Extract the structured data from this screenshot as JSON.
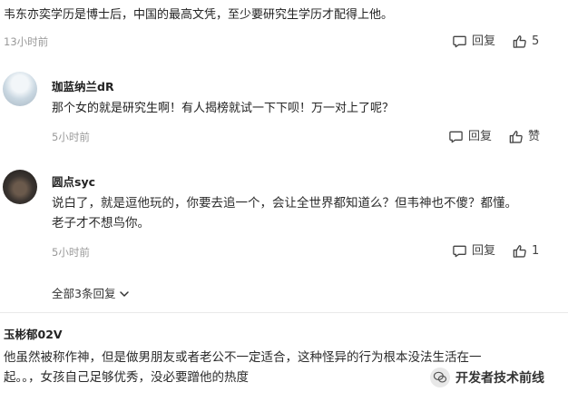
{
  "comment0": {
    "text": "韦东亦奕学历是博士后，中国的最高文凭，至少要研究生学历才配得上他。",
    "time": "13小时前",
    "reply_label": "回复",
    "like_count": "5"
  },
  "comment1": {
    "username": "珈蓝纳兰dR",
    "text": "那个女的就是研究生啊！有人揭榜就试一下下呗！万一对上了呢？",
    "time": "5小时前",
    "reply_label": "回复",
    "like_label": "赞"
  },
  "comment2": {
    "username": "圆点syc",
    "text_line1": "说白了，就是逗他玩的，你要去追一个，会让全世界都知道么？但韦神也不傻？都懂。",
    "text_line2": "老子才不想鸟你。",
    "time": "5小时前",
    "reply_label": "回复",
    "like_count": "1",
    "expand_label": "全部3条回复"
  },
  "comment3": {
    "username": "玉彬郁02V",
    "text_line1": "他虽然被称作神，但是做男朋友或者老公不一定适合，这种怪异的行为根本没法生活在一",
    "text_line2": "起。。，女孩自己足够优秀，没必要蹭他的热度"
  },
  "watermark": {
    "text": "开发者技术前线"
  },
  "icons": {
    "reply": "comment-bubble-icon",
    "like": "thumbs-up-icon",
    "expand": "chevron-down-icon",
    "watermark": "wechat-logo-icon"
  }
}
